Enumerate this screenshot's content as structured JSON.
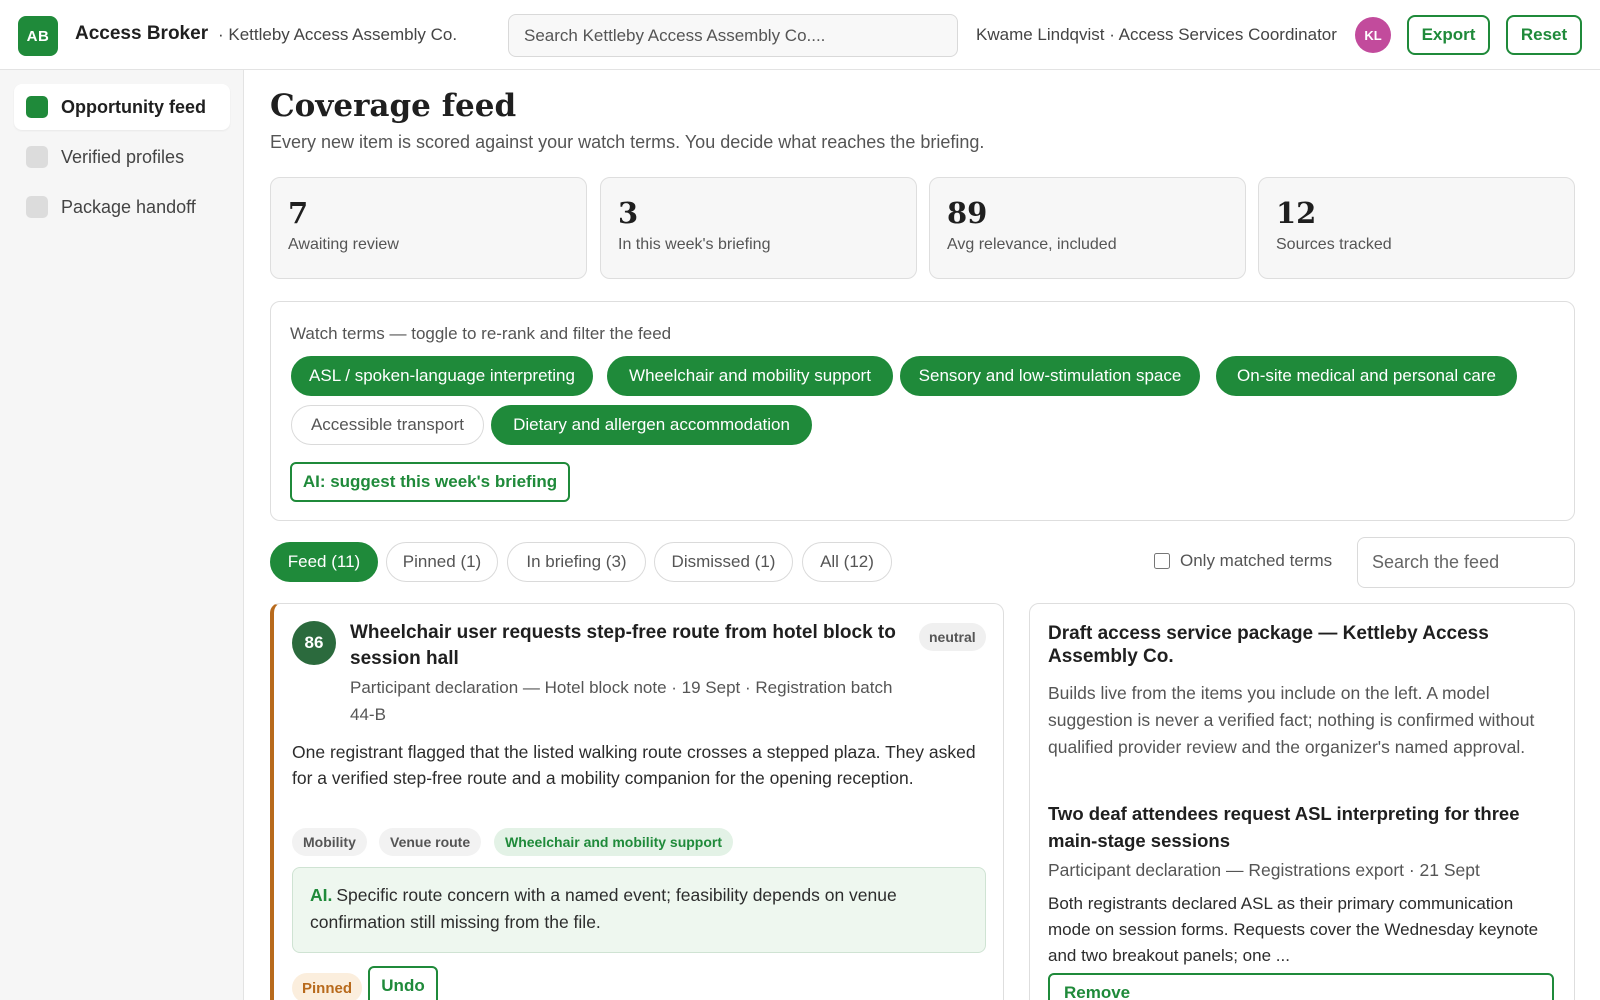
{
  "header": {
    "logo": "AB",
    "app_name": "Access Broker",
    "org_name": "· Kettleby Access Assembly Co.",
    "search_placeholder": "Search Kettleby Access Assembly Co....",
    "user": "Kwame Lindqvist · Access Services Coordinator",
    "avatar": "KL",
    "export_label": "Export",
    "reset_label": "Reset"
  },
  "sidebar": {
    "items": [
      {
        "label": "Opportunity feed",
        "active": true
      },
      {
        "label": "Verified profiles",
        "active": false
      },
      {
        "label": "Package handoff",
        "active": false
      }
    ]
  },
  "main": {
    "title": "Coverage feed",
    "subtitle": "Every new item is scored against your watch terms. You decide what reaches the briefing.",
    "stats": [
      {
        "value": "7",
        "label": "Awaiting review"
      },
      {
        "value": "3",
        "label": "In this week's briefing"
      },
      {
        "value": "89",
        "label": "Avg relevance, included"
      },
      {
        "value": "12",
        "label": "Sources tracked"
      }
    ],
    "watch": {
      "label": "Watch terms — toggle to re-rank and filter the feed",
      "terms": [
        {
          "label": "ASL / spoken-language interpreting",
          "on": true
        },
        {
          "label": "Wheelchair and mobility support",
          "on": true
        },
        {
          "label": "Sensory and low-stimulation space",
          "on": true
        },
        {
          "label": "On-site medical and personal care",
          "on": true
        },
        {
          "label": "Accessible transport",
          "on": false
        },
        {
          "label": "Dietary and allergen accommodation",
          "on": true
        }
      ],
      "ai_button": "AI: suggest this week's briefing"
    },
    "tabs": [
      {
        "label": "Feed (11)",
        "active": true
      },
      {
        "label": "Pinned (1)",
        "active": false
      },
      {
        "label": "In briefing (3)",
        "active": false
      },
      {
        "label": "Dismissed (1)",
        "active": false
      },
      {
        "label": "All (12)",
        "active": false
      }
    ],
    "only_matched_label": "Only matched terms",
    "feed_search_placeholder": "Search the feed"
  },
  "feed_card": {
    "score": "86",
    "title": "Wheelchair user requests step-free route from hotel block to session hall",
    "badge": "neutral",
    "meta": "Participant declaration — Hotel block note · 19 Sept · Registration batch 44-B",
    "body": "One registrant flagged that the listed walking route crosses a stepped plaza. They asked for a verified step-free route and a mobility companion for the opening reception.",
    "tags": [
      "Mobility",
      "Venue route",
      "Wheelchair and mobility support"
    ],
    "ai_prefix": "AI.",
    "ai_text": "Specific route concern with a named event; feasibility depends on venue confirmation still missing from the file.",
    "pinned_label": "Pinned",
    "undo_label": "Undo"
  },
  "draft": {
    "title": "Draft access service package — Kettleby Access Assembly Co.",
    "description": "Builds live from the items you include on the left. A model suggestion is never a verified fact; nothing is confirmed without qualified provider review and the organizer's named approval.",
    "item_title": "Two deaf attendees request ASL interpreting for three main-stage sessions",
    "item_meta": "Participant declaration — Registrations export · 21 Sept",
    "item_body": "Both registrants declared ASL as their primary communication mode on session forms. Requests cover the Wednesday keynote and two breakout panels; one ...",
    "remove_label": "Remove"
  },
  "colors": {
    "accent": "#1f8a3a",
    "pinned_accent": "#b86a1c",
    "avatar": "#c24b9c"
  }
}
